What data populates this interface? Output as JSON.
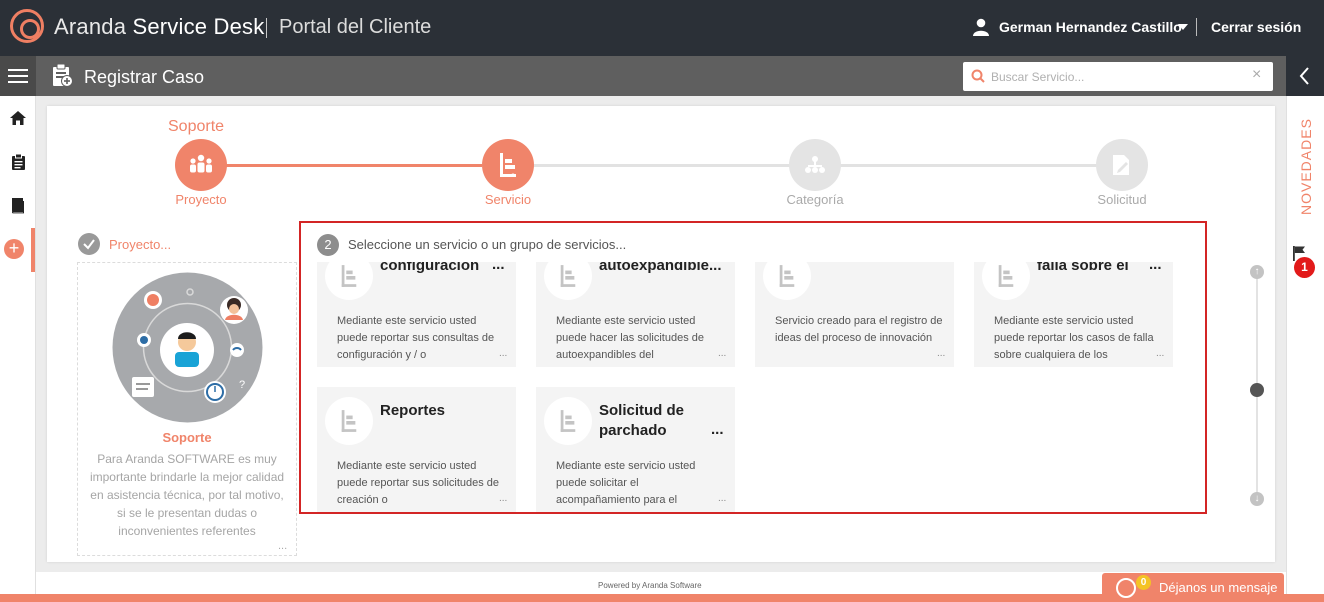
{
  "header": {
    "brand_light": "Aranda",
    "brand_bold": "Service Desk",
    "portal": "Portal del Cliente",
    "user_name": "German Hernandez Castillo",
    "logout": "Cerrar sesión"
  },
  "toolbar": {
    "title": "Registrar Caso",
    "search_placeholder": "Buscar Servicio...",
    "search_clear": "×"
  },
  "sidenav": {
    "items": [
      "home-icon",
      "clipboard-icon",
      "book-icon",
      "plus-icon"
    ]
  },
  "novedades": {
    "label": "NOVEDADES",
    "badge": "1"
  },
  "wizard": {
    "project_name_top": "Soporte",
    "steps": [
      {
        "label": "Proyecto",
        "state": "done"
      },
      {
        "label": "Servicio",
        "state": "active"
      },
      {
        "label": "Categoría",
        "state": "pending"
      },
      {
        "label": "Solicitud",
        "state": "pending"
      }
    ]
  },
  "project_panel": {
    "heading": "Proyecto...",
    "name": "Soporte",
    "description": "Para Aranda SOFTWARE es muy importante brindarle la mejor calidad en asistencia técnica, por tal motivo, si se le presentan dudas o inconvenientes referentes",
    "dots": "..."
  },
  "services": {
    "step_number": "2",
    "title": "Seleccione un servicio o un grupo de servicios...",
    "items": [
      {
        "title": "configuración",
        "more": "...",
        "desc": "Mediante este servicio usted puede reportar sus consultas de configuración y / o",
        "dots": "..."
      },
      {
        "title": "autoexpandible...",
        "more": "",
        "desc": "Mediante este servicio usted puede hacer las solicitudes de autoexpandibles del",
        "dots": "..."
      },
      {
        "title": "",
        "more": "",
        "desc": "Servicio creado para el registro de ideas del proceso de innovación",
        "dots": "..."
      },
      {
        "title": "falla sobre el",
        "more": "...",
        "desc": "Mediante este servicio usted puede reportar los casos de falla sobre cualquiera de los",
        "dots": "..."
      },
      {
        "title": "Reportes",
        "more": "",
        "desc": "Mediante este servicio usted puede reportar sus solicitudes de creación o",
        "dots": "..."
      },
      {
        "title": "Solicitud de parchado",
        "more": "...",
        "desc": "Mediante este servicio usted puede solicitar el acompañamiento para el",
        "dots": "..."
      }
    ]
  },
  "footer": {
    "powered": "Powered by Aranda Software",
    "message_badge": "0",
    "message_label": "Déjanos un mensaje"
  },
  "colors": {
    "accent": "#f0846a",
    "topbar": "#2b3037",
    "subbar": "#5f5f5f",
    "highlight_border": "#d32525"
  }
}
